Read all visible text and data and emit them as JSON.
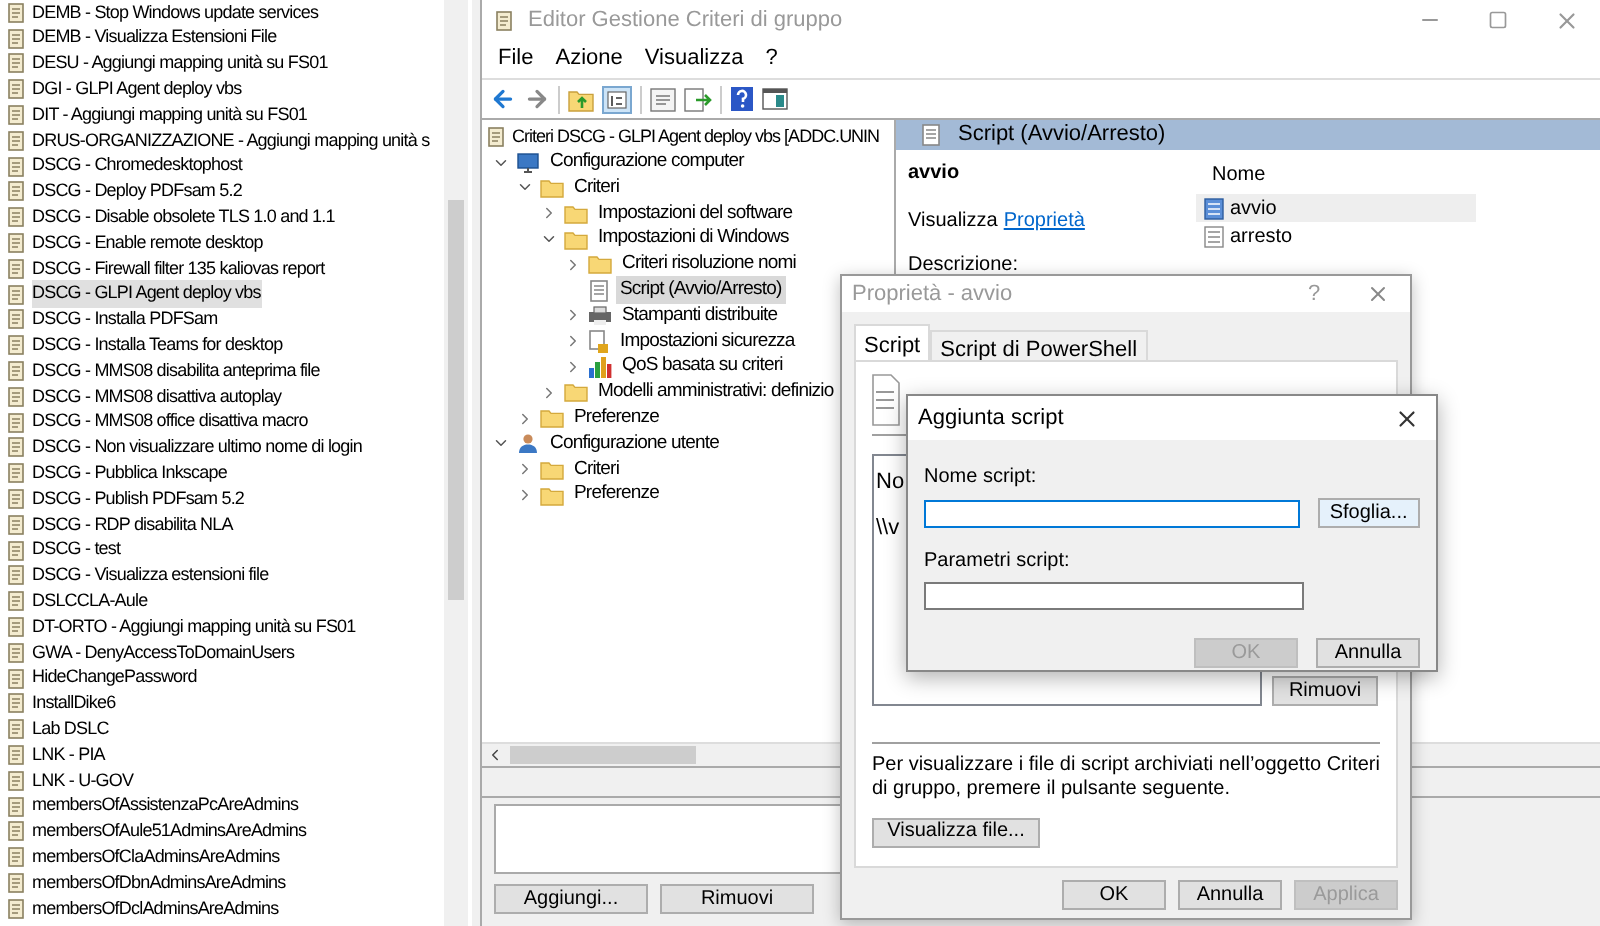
{
  "gpo_list": {
    "items": [
      {
        "label": "DEMB - Stop Windows update services",
        "selected": false
      },
      {
        "label": "DEMB - Visualizza Estensioni File",
        "selected": false
      },
      {
        "label": "DESU - Aggiungi mapping unità su FS01",
        "selected": false
      },
      {
        "label": "DGI - GLPI Agent deploy vbs",
        "selected": false
      },
      {
        "label": "DIT - Aggiungi mapping unità su FS01",
        "selected": false
      },
      {
        "label": "DRUS-ORGANIZZAZIONE - Aggiungi mapping unità s",
        "selected": false
      },
      {
        "label": "DSCG - Chromedesktophost",
        "selected": false
      },
      {
        "label": "DSCG - Deploy PDFsam 5.2",
        "selected": false
      },
      {
        "label": "DSCG - Disable obsolete TLS 1.0 and 1.1",
        "selected": false
      },
      {
        "label": "DSCG - Enable remote desktop",
        "selected": false
      },
      {
        "label": "DSCG - Firewall filter 135 kaliovas report",
        "selected": false
      },
      {
        "label": "DSCG - GLPI Agent deploy vbs",
        "selected": true
      },
      {
        "label": "DSCG - Installa PDFSam",
        "selected": false
      },
      {
        "label": "DSCG - Installa Teams for desktop",
        "selected": false
      },
      {
        "label": "DSCG - MMS08 disabilita anteprima file",
        "selected": false
      },
      {
        "label": "DSCG - MMS08 disattiva autoplay",
        "selected": false
      },
      {
        "label": "DSCG - MMS08 office disattiva macro",
        "selected": false
      },
      {
        "label": "DSCG - Non visualizzare ultimo nome di login",
        "selected": false
      },
      {
        "label": "DSCG - Pubblica Inkscape",
        "selected": false
      },
      {
        "label": "DSCG - Publish PDFsam 5.2",
        "selected": false
      },
      {
        "label": "DSCG - RDP disabilita NLA",
        "selected": false
      },
      {
        "label": "DSCG - test",
        "selected": false
      },
      {
        "label": "DSCG - Visualizza estensioni file",
        "selected": false
      },
      {
        "label": "DSLCCLA-Aule",
        "selected": false
      },
      {
        "label": "DT-ORTO - Aggiungi mapping unità su FS01",
        "selected": false
      },
      {
        "label": "GWA - DenyAccessToDomainUsers",
        "selected": false
      },
      {
        "label": "HideChangePassword",
        "selected": false
      },
      {
        "label": "InstallDike6",
        "selected": false
      },
      {
        "label": "Lab DSLC",
        "selected": false
      },
      {
        "label": "LNK - PIA",
        "selected": false
      },
      {
        "label": "LNK - U-GOV",
        "selected": false
      },
      {
        "label": "membersOfAssistenzaPcAreAdmins",
        "selected": false
      },
      {
        "label": "membersOfAule51AdminsAreAdmins",
        "selected": false
      },
      {
        "label": "membersOfClaAdminsAreAdmins",
        "selected": false
      },
      {
        "label": "membersOfDbnAdminsAreAdmins",
        "selected": false
      },
      {
        "label": "membersOfDclAdminsAreAdmins",
        "selected": false
      }
    ]
  },
  "editor": {
    "title": "Editor Gestione Criteri di gruppo",
    "menu": [
      "File",
      "Azione",
      "Visualizza",
      "?"
    ],
    "tree": {
      "root": "Criteri DSCG - GLPI Agent deploy vbs [ADDC.UNIN",
      "children": [
        {
          "label": "Configurazione computer",
          "kind": "computer",
          "expanded": true,
          "selected": false,
          "children": [
            {
              "label": "Criteri",
              "kind": "folder",
              "expanded": true,
              "selected": false,
              "children": [
                {
                  "label": "Impostazioni del software",
                  "kind": "folder",
                  "expanded": false,
                  "selected": false
                },
                {
                  "label": "Impostazioni di Windows",
                  "kind": "folder",
                  "expanded": true,
                  "selected": false,
                  "children": [
                    {
                      "label": "Criteri risoluzione nomi",
                      "kind": "folder",
                      "expanded": false,
                      "selected": false
                    },
                    {
                      "label": "Script (Avvio/Arresto)",
                      "kind": "script",
                      "selected": true
                    },
                    {
                      "label": "Stampanti distribuite",
                      "kind": "printer",
                      "expanded": false,
                      "selected": false
                    },
                    {
                      "label": "Impostazioni sicurezza",
                      "kind": "security",
                      "expanded": false,
                      "selected": false
                    },
                    {
                      "label": "QoS basata su criteri",
                      "kind": "chart",
                      "expanded": false,
                      "selected": false
                    }
                  ]
                },
                {
                  "label": "Modelli amministrativi: definizio",
                  "kind": "folder",
                  "expanded": false,
                  "selected": false
                }
              ]
            },
            {
              "label": "Preferenze",
              "kind": "folder",
              "expanded": false,
              "selected": false
            }
          ]
        },
        {
          "label": "Configurazione utente",
          "kind": "user",
          "expanded": true,
          "selected": false,
          "children": [
            {
              "label": "Criteri",
              "kind": "folder",
              "expanded": false,
              "selected": false
            },
            {
              "label": "Preferenze",
              "kind": "folder",
              "expanded": false,
              "selected": false
            }
          ]
        }
      ]
    },
    "details": {
      "header": "Script (Avvio/Arresto)",
      "heading": "avvio",
      "link_prefix": "Visualizza",
      "link": "Proprietà",
      "description_label": "Descrizione:",
      "column": "Nome",
      "items": [
        {
          "label": "avvio",
          "kind": "startup",
          "selected": true
        },
        {
          "label": "arresto",
          "kind": "shutdown",
          "selected": false
        }
      ]
    },
    "buttons": [
      "Aggiungi...",
      "Rimuovi"
    ]
  },
  "properties_dialog": {
    "title": "Proprietà - avvio",
    "help": "?",
    "tabs": [
      {
        "label": "Script",
        "selected": true
      },
      {
        "label": "Script di PowerShell",
        "selected": false
      }
    ],
    "list": {
      "column": "No",
      "rows": [
        "\\\\v"
      ]
    },
    "remove_button": "Rimuovi",
    "note": "Per visualizzare i file di script archiviati nell’oggetto Criteri di gruppo, premere il pulsante seguente.",
    "view_files_button": "Visualizza file...",
    "buttons": [
      {
        "label": "OK",
        "disabled": false
      },
      {
        "label": "Annulla",
        "disabled": false
      },
      {
        "label": "Applica",
        "disabled": true
      }
    ]
  },
  "add_script_dialog": {
    "title": "Aggiunta script",
    "fields": [
      {
        "label": "Nome script:",
        "focused": true
      },
      {
        "label": "Parametri script:",
        "focused": false
      }
    ],
    "browse_button": "Sfoglia...",
    "buttons": [
      {
        "label": "OK",
        "disabled": true
      },
      {
        "label": "Annulla",
        "disabled": false
      }
    ]
  }
}
